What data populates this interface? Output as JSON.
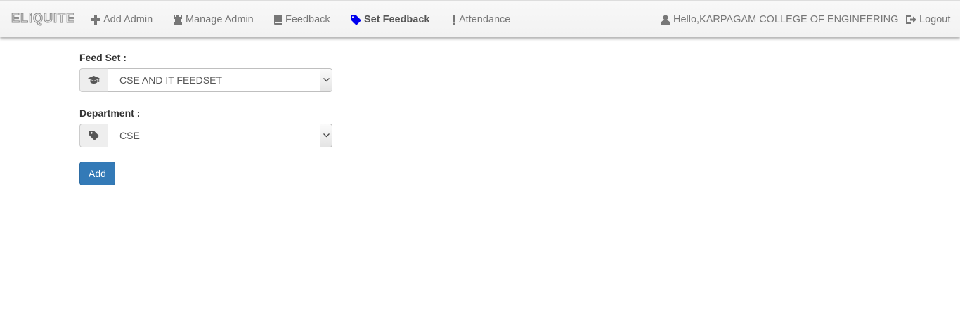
{
  "navbar": {
    "brand": "ELiQUITE",
    "items": [
      {
        "label": "Add Admin",
        "icon": "plus-icon"
      },
      {
        "label": "Manage Admin",
        "icon": "tower-icon"
      },
      {
        "label": "Feedback",
        "icon": "book-icon"
      },
      {
        "label": "Set Feedback",
        "icon": "tag-icon",
        "active": true,
        "icon_color": "#0000ee"
      },
      {
        "label": "Attendance",
        "icon": "exclamation-icon"
      }
    ],
    "user": {
      "label": "Hello,KARPAGAM COLLEGE OF ENGINEERING",
      "icon": "user-icon"
    },
    "logout": {
      "label": "Logout",
      "icon": "logout-icon"
    }
  },
  "form": {
    "feedset": {
      "label": "Feed Set :",
      "value": "CSE AND IT FEEDSET",
      "icon": "graduation-cap-icon"
    },
    "department": {
      "label": "Department :",
      "value": "CSE",
      "icon": "tag-icon"
    },
    "add_button": "Add"
  },
  "colors": {
    "primary": "#337ab7",
    "active_icon": "#0000ee",
    "nav_text": "#777777"
  }
}
